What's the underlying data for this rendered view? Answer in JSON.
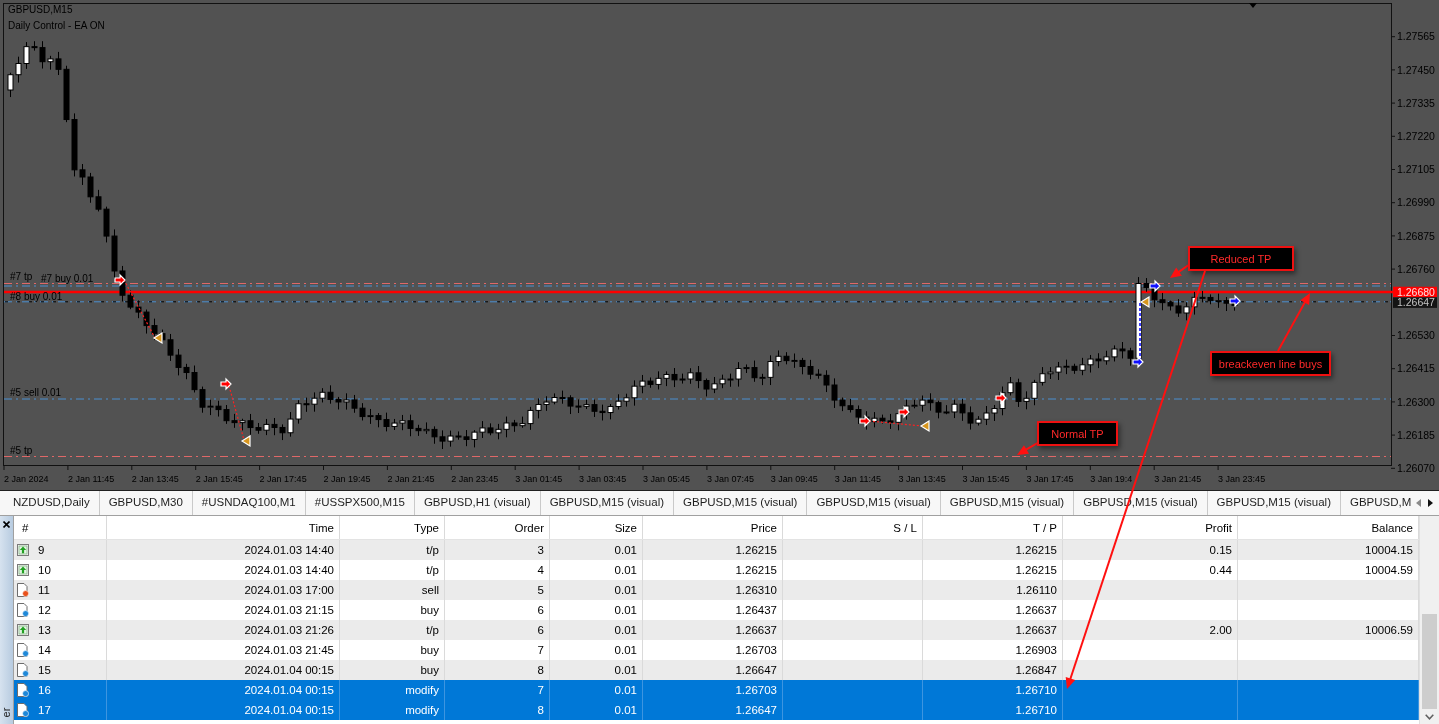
{
  "chart": {
    "title": "GBPUSD,M15",
    "subtitle": "Daily Control - EA ON",
    "price_axis": [
      "1.27565",
      "1.27450",
      "1.27335",
      "1.27220",
      "1.27105",
      "1.26990",
      "1.26875",
      "1.26760",
      "1.26530",
      "1.26415",
      "1.26300",
      "1.26185",
      "1.26070"
    ],
    "price_tags": [
      {
        "kind": "ask",
        "text": "1.26680"
      },
      {
        "kind": "bid",
        "text": "1.26647"
      }
    ],
    "time_axis": [
      "2 Jan 2024",
      "2 Jan 11:45",
      "2 Jan 13:45",
      "2 Jan 15:45",
      "2 Jan 17:45",
      "2 Jan 19:45",
      "2 Jan 21:45",
      "2 Jan 23:45",
      "3 Jan 01:45",
      "3 Jan 03:45",
      "3 Jan 05:45",
      "3 Jan 07:45",
      "3 Jan 09:45",
      "3 Jan 11:45",
      "3 Jan 13:45",
      "3 Jan 15:45",
      "3 Jan 17:45",
      "3 Jan 19:4",
      "3 Jan 21:45",
      "3 Jan 23:45"
    ],
    "order_labels": [
      "#7 tp",
      "#7 buy 0.01",
      "#8 buy 0.01",
      "#5 sell 0.01",
      "#5 tp"
    ],
    "callouts": [
      "Reduced TP",
      "breackeven line buys",
      "Normal TP"
    ]
  },
  "tabs": [
    {
      "label": "NZDUSD,Daily",
      "selected": false
    },
    {
      "label": "GBPUSD,M30",
      "selected": false
    },
    {
      "label": "#USNDAQ100,M1",
      "selected": false
    },
    {
      "label": "#USSPX500,M15",
      "selected": false
    },
    {
      "label": "GBPUSD,H1 (visual)",
      "selected": false
    },
    {
      "label": "GBPUSD,M15 (visual)",
      "selected": false
    },
    {
      "label": "GBPUSD,M15 (visual)",
      "selected": false
    },
    {
      "label": "GBPUSD,M15 (visual)",
      "selected": false
    },
    {
      "label": "GBPUSD,M15 (visual)",
      "selected": false
    },
    {
      "label": "GBPUSD,M15 (visual)",
      "selected": false
    },
    {
      "label": "GBPUSD,M15 (visual)",
      "selected": false
    },
    {
      "label": "GBPUSD,M",
      "selected": false
    }
  ],
  "terminal": {
    "side_label": "er",
    "table": {
      "columns": [
        "#",
        "Time",
        "Type",
        "Order",
        "Size",
        "Price",
        "S / L",
        "T / P",
        "Profit",
        "Balance"
      ],
      "rows": [
        {
          "kind": "tp",
          "number": "9",
          "time": "2024.01.03 14:40",
          "type": "t/p",
          "order": "3",
          "size": "0.01",
          "price": "1.26215",
          "tp": "1.26215",
          "profit": "0.15",
          "balance": "10004.15",
          "selected": false
        },
        {
          "kind": "tp",
          "number": "10",
          "time": "2024.01.03 14:40",
          "type": "t/p",
          "order": "4",
          "size": "0.01",
          "price": "1.26215",
          "tp": "1.26215",
          "profit": "0.44",
          "balance": "10004.59",
          "selected": false
        },
        {
          "kind": "sell",
          "number": "11",
          "time": "2024.01.03 17:00",
          "type": "sell",
          "order": "5",
          "size": "0.01",
          "price": "1.26310",
          "tp": "1.26110",
          "selected": false
        },
        {
          "kind": "buy",
          "number": "12",
          "time": "2024.01.03 21:15",
          "type": "buy",
          "order": "6",
          "size": "0.01",
          "price": "1.26437",
          "tp": "1.26637",
          "selected": false
        },
        {
          "kind": "tp",
          "number": "13",
          "time": "2024.01.03 21:26",
          "type": "t/p",
          "order": "6",
          "size": "0.01",
          "price": "1.26637",
          "tp": "1.26637",
          "profit": "2.00",
          "balance": "10006.59",
          "selected": false
        },
        {
          "kind": "buy",
          "number": "14",
          "time": "2024.01.03 21:45",
          "type": "buy",
          "order": "7",
          "size": "0.01",
          "price": "1.26703",
          "tp": "1.26903",
          "selected": false
        },
        {
          "kind": "buy",
          "number": "15",
          "time": "2024.01.04 00:15",
          "type": "buy",
          "order": "8",
          "size": "0.01",
          "price": "1.26647",
          "tp": "1.26847",
          "selected": false
        },
        {
          "kind": "modify",
          "number": "16",
          "time": "2024.01.04 00:15",
          "type": "modify",
          "order": "7",
          "size": "0.01",
          "price": "1.26703",
          "tp": "1.26710",
          "selected": true
        },
        {
          "kind": "modify",
          "number": "17",
          "time": "2024.01.04 00:15",
          "type": "modify",
          "order": "8",
          "size": "0.01",
          "price": "1.26647",
          "tp": "1.26710",
          "selected": true
        }
      ]
    }
  }
}
